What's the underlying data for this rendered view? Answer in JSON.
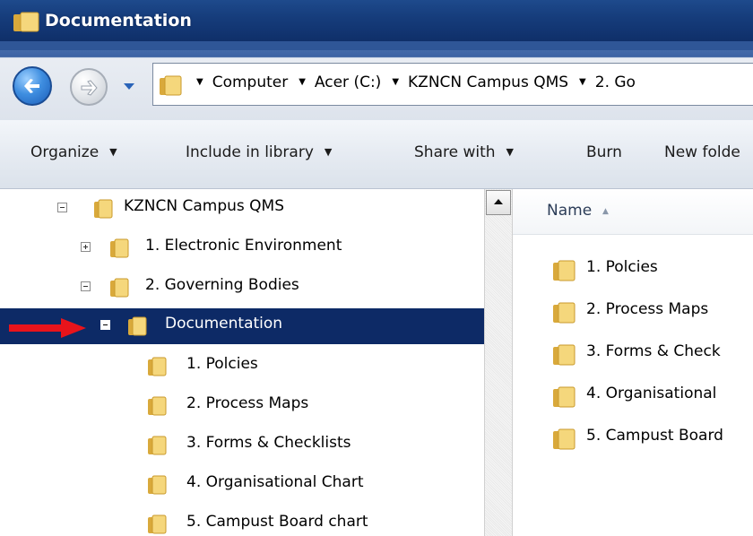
{
  "window": {
    "title": "Documentation"
  },
  "address": {
    "crumbs": [
      "Computer",
      "Acer (C:)",
      "KZNCN Campus QMS",
      "2. Go"
    ]
  },
  "toolbar": {
    "organize": "Organize",
    "include_library": "Include in library",
    "share_with": "Share with",
    "burn": "Burn",
    "new_folder": "New folde"
  },
  "tree": {
    "items": [
      {
        "label": "KZNCN Campus QMS",
        "expander": "minus",
        "level": 0
      },
      {
        "label": "1. Electronic Environment",
        "expander": "plus",
        "level": 1
      },
      {
        "label": "2. Governing Bodies",
        "expander": "minus",
        "level": 1
      },
      {
        "label": "Documentation",
        "expander": "minus",
        "level": 2,
        "selected": true
      },
      {
        "label": "1. Polcies",
        "level": 3
      },
      {
        "label": "2. Process Maps",
        "level": 3
      },
      {
        "label": "3. Forms & Checklists",
        "level": 3
      },
      {
        "label": "4. Organisational Chart",
        "level": 3
      },
      {
        "label": "5. Campust Board chart",
        "level": 3
      }
    ]
  },
  "content": {
    "column_name": "Name",
    "items": [
      "1. Polcies",
      "2. Process Maps",
      "3. Forms & Check",
      "4. Organisational",
      "5. Campust Board"
    ]
  },
  "colors": {
    "title_bar": "#163d7c",
    "selection": "#0d2a66",
    "annotation_arrow": "#e8141b",
    "folder": "#e8c35a"
  }
}
